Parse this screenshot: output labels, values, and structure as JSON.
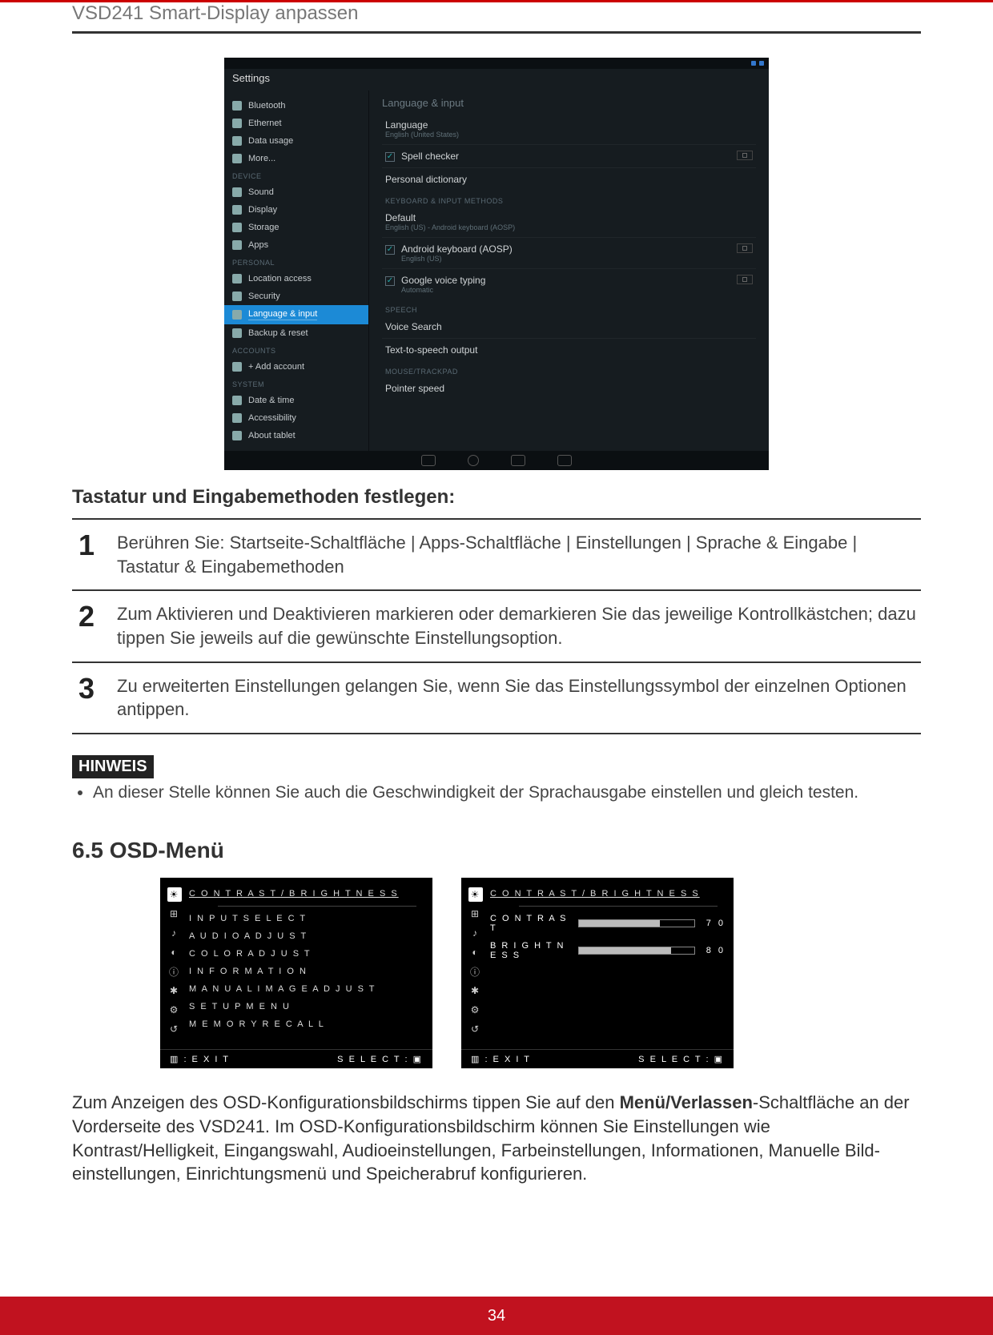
{
  "header": {
    "title": "VSD241 Smart-Display anpassen"
  },
  "android": {
    "app_title": "Settings",
    "side_sections": [
      {
        "label": "",
        "items": [
          "Bluetooth",
          "Ethernet",
          "Data usage",
          "More..."
        ]
      },
      {
        "label": "DEVICE",
        "items": [
          "Sound",
          "Display",
          "Storage",
          "Apps"
        ]
      },
      {
        "label": "PERSONAL",
        "items": [
          "Location access",
          "Security",
          "Language & input",
          "Backup & reset"
        ]
      },
      {
        "label": "ACCOUNTS",
        "items": [
          "+ Add account"
        ]
      },
      {
        "label": "SYSTEM",
        "items": [
          "Date & time",
          "Accessibility",
          "About tablet"
        ]
      }
    ],
    "selected_item": "Language & input",
    "main": {
      "title": "Language & input",
      "rows": [
        {
          "t1": "Language",
          "t2": "English (United States)",
          "toggle": false
        },
        {
          "t1": "Spell checker",
          "t2": "",
          "checked": true,
          "toggle": true
        },
        {
          "t1": "Personal dictionary",
          "t2": ""
        }
      ],
      "kb_head": "KEYBOARD & INPUT METHODS",
      "kb_rows": [
        {
          "t1": "Default",
          "t2": "English (US) - Android keyboard (AOSP)"
        },
        {
          "t1": "Android keyboard (AOSP)",
          "t2": "English (US)",
          "checked": true,
          "toggle": true
        },
        {
          "t1": "Google voice typing",
          "t2": "Automatic",
          "checked": true,
          "toggle": true
        }
      ],
      "speech_head": "SPEECH",
      "speech_rows": [
        {
          "t1": "Voice Search"
        },
        {
          "t1": "Text-to-speech output"
        }
      ],
      "mouse_head": "MOUSE/TRACKPAD",
      "mouse_rows": [
        {
          "t1": "Pointer speed"
        }
      ]
    }
  },
  "subheading": "Tastatur und Eingabemethoden festlegen:",
  "steps": [
    {
      "n": "1",
      "t": "Berühren Sie: Startseite-Schaltfläche | Apps-Schaltfläche | Einstellungen | Sprache & Eingabe | Tastatur & Eingabemethoden"
    },
    {
      "n": "2",
      "t": "Zum Aktivieren und Deaktivieren markieren oder demarkieren Sie das jeweilige Kontrollkästchen; dazu tippen Sie jeweils auf die gewünschte Einstellungsoption."
    },
    {
      "n": "3",
      "t": "Zu erweiterten Einstellungen gelangen Sie, wenn Sie das Einstellungssymbol der einzelnen Optionen antippen."
    }
  ],
  "hinweis": {
    "label": "HINWEIS",
    "items": [
      "An dieser Stelle können Sie auch die Geschwindigkeit der Sprachausgabe einstellen und gleich testen."
    ]
  },
  "section_6_5": "6.5  OSD-Menü",
  "osd_left": {
    "icons": [
      "☀",
      "⊞",
      "♪",
      "◐",
      "ⓘ",
      "✱",
      "⚙",
      "↺"
    ],
    "items": [
      "C O N T R A S T /  B R I G H T N E S S",
      "I N P U T   S E L E C T",
      "A U D I O   A D J U S T",
      "C O L O R   A D J U S T",
      "I N F O R M A T I O N",
      "M A N U A L   I M A G E   A D J U S T",
      "S E T U P   M E N U",
      "M E M O R Y  R E C A L L"
    ],
    "footer_left": "▥ : E X I T",
    "footer_right": "S E L E C T : ▣"
  },
  "osd_right": {
    "icons": [
      "☀",
      "⊞",
      "♪",
      "◐",
      "ⓘ",
      "✱",
      "⚙",
      "↺"
    ],
    "title": "C O N T R A S T / B R I G H T N E S S",
    "rows": [
      {
        "label": "C O N T R A S T",
        "value": "7 0",
        "pct": 70
      },
      {
        "label": "B R I G H T N E S S",
        "value": "8 0",
        "pct": 80
      }
    ],
    "footer_left": "▥ : E X I T",
    "footer_right": "S E L E C T : ▣"
  },
  "body_paragraph": {
    "pre": "Zum Anzeigen des OSD-Konfigurationsbildschirms tippen Sie auf den ",
    "bold": "Menü/Verlassen",
    "post": "-Schaltfläche an der Vorderseite des VSD241. Im OSD-Konfigura­tionsbildschirm können Sie Einstellungen wie Kontrast/Helligkeit, Eingangs­wahl, Audioeinstellungen, Farbeinstellungen, Informationen, Manuelle Bild­einstellungen, Einrichtungsmenü und Speicherabruf konfigurieren."
  },
  "page_number": "34"
}
